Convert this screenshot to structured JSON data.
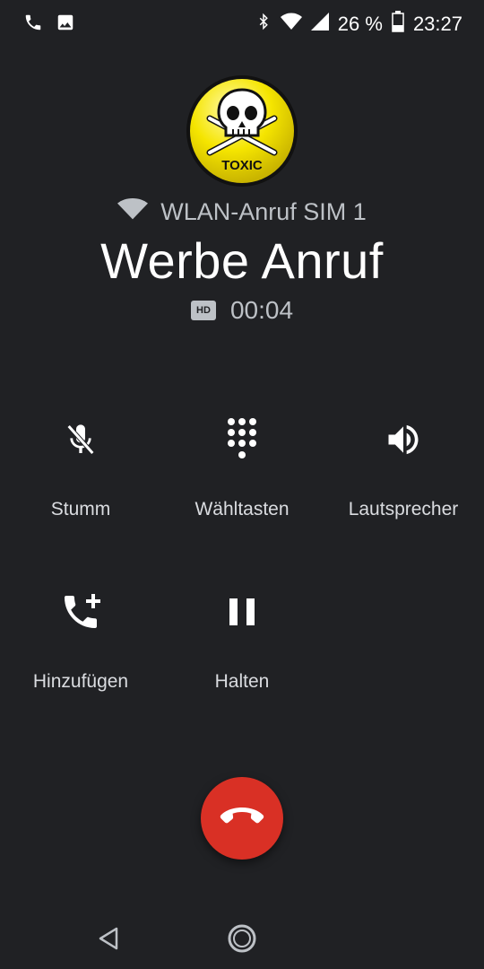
{
  "status_bar": {
    "battery_percent": "26 %",
    "time": "23:27",
    "icons": [
      "phone-icon",
      "image-icon",
      "bluetooth-icon",
      "wifi-icon",
      "cell-signal-icon",
      "battery-icon"
    ]
  },
  "call": {
    "avatar_label": "TOXIC",
    "network_label": "WLAN-Anruf SIM 1",
    "caller_name": "Werbe Anruf",
    "hd_label": "HD",
    "duration": "00:04"
  },
  "actions": {
    "mute": "Stumm",
    "dialpad": "Wähltasten",
    "speaker": "Lautsprecher",
    "add_call": "Hinzufügen",
    "hold": "Halten"
  },
  "colors": {
    "background": "#202124",
    "end_call": "#d93025",
    "avatar_yellow": "#f5e500"
  }
}
